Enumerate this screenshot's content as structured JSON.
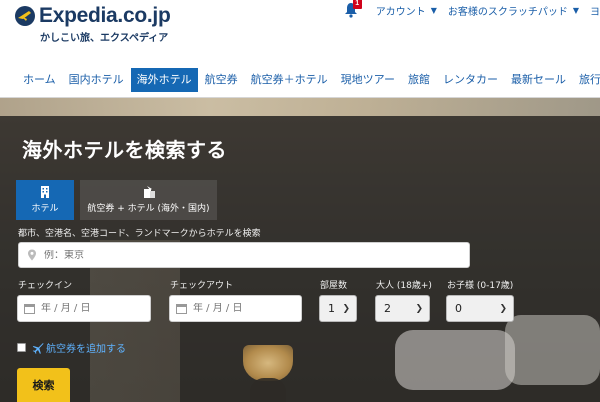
{
  "brand": {
    "name": "Expedia.co.jp",
    "tagline": "かしこい旅、エクスペディア"
  },
  "topbar": {
    "notification_count": "1",
    "account_label": "アカウント",
    "scratchpad_label": "お客様のスクラッチパッド",
    "more_label": "ヨ"
  },
  "nav": {
    "items": [
      "ホーム",
      "国内ホテル",
      "海外ホテル",
      "航空券",
      "航空券＋ホテル",
      "現地ツアー",
      "旅館",
      "レンタカー",
      "最新セール",
      "旅行ア"
    ],
    "active_index": 2
  },
  "hero": {
    "title": "海外ホテルを検索する"
  },
  "tabs": {
    "hotel": "ホテル",
    "package": "航空券 + ホテル (海外・国内)"
  },
  "search": {
    "hint": "都市、空港名、空港コード、ランドマークからホテルを検索",
    "placeholder": "例：東京",
    "checkin_label": "チェックイン",
    "checkout_label": "チェックアウト",
    "date_placeholder": "年 / 月 / 日",
    "rooms_label": "部屋数",
    "rooms_value": "1",
    "adults_label": "大人 (18歳+)",
    "adults_value": "2",
    "children_label": "お子様 (0-17歳)",
    "children_value": "0",
    "add_flight_label": "航空券を追加する",
    "submit_label": "検索"
  },
  "colors": {
    "brand_blue": "#1568b4",
    "logo_navy": "#1b3a63",
    "search_button": "#f2c11a",
    "badge_red": "#d0021b",
    "link_blue": "#1a5ea8"
  },
  "icons": [
    "globe-logo-icon",
    "bell-icon",
    "chevron-down-icon",
    "hotel-building-icon",
    "package-icon",
    "location-pin-icon",
    "calendar-icon",
    "plane-icon"
  ]
}
